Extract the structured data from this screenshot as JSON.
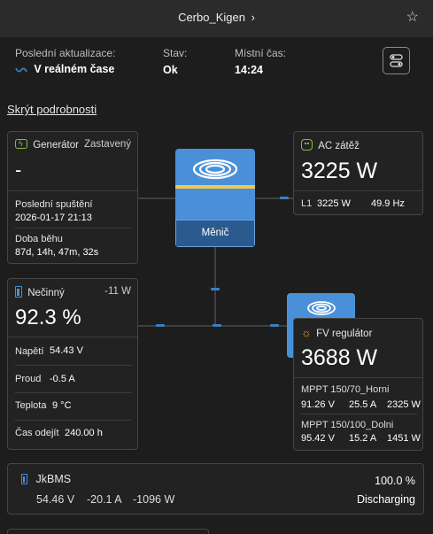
{
  "header": {
    "title": "Cerbo_Kigen",
    "chevron": "›",
    "star": "☆"
  },
  "status": {
    "last_update_label": "Poslední aktualizace:",
    "last_update_value": "V reálném čase",
    "state_label": "Stav:",
    "state_value": "Ok",
    "local_time_label": "Místní čas:",
    "local_time_value": "14:24"
  },
  "toggle_details": "Skrýt podrobnosti",
  "generator": {
    "title": "Generátor",
    "state": "Zastavený",
    "value": "-",
    "last_run_label": "Poslední spuštění",
    "last_run_value": "2026-01-17 21:13",
    "runtime_label": "Doba běhu",
    "runtime_value": "87d, 14h, 47m, 32s"
  },
  "inverter": {
    "label": "Měnič"
  },
  "ac_load": {
    "title": "AC zátěž",
    "value": "3225 W",
    "phase_label": "L1",
    "phase_power": "3225 W",
    "frequency": "49.9 Hz"
  },
  "battery": {
    "title": "Nečinný",
    "power": "-11 W",
    "soc": "92.3 %",
    "voltage_label": "Napětí",
    "voltage_value": "54.43 V",
    "current_label": "Proud",
    "current_value": "-0.5 A",
    "temp_label": "Teplota",
    "temp_value": "9 °C",
    "ttg_label": "Čas odejít",
    "ttg_value": "240.00 h"
  },
  "solar": {
    "title": "FV regulátor",
    "value": "3688 W",
    "chargers": [
      {
        "name": "MPPT 150/70_Horni",
        "voltage": "91.26 V",
        "current": "25.5 A",
        "power": "2325 W"
      },
      {
        "name": "MPPT 150/100_Dolni",
        "voltage": "95.42 V",
        "current": "15.2 A",
        "power": "1451 W"
      }
    ]
  },
  "bms": {
    "title": "JkBMS",
    "soc": "100.0 %",
    "voltage": "54.46 V",
    "current": "-20.1 A",
    "power": "-1096 W",
    "state": "Discharging"
  },
  "colors": {
    "accent": "#3a7fc1",
    "tile": "#4a90d9",
    "yellow": "#f2c94c",
    "green": "#7bc043",
    "orange": "#f0a030"
  }
}
